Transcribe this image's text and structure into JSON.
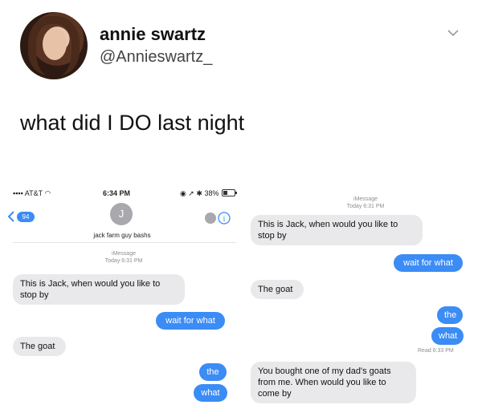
{
  "tweet": {
    "name": "annie swartz",
    "handle": "@Annieswartz_",
    "text": "what did I DO last night"
  },
  "left_screen": {
    "status_carrier": "AT&T",
    "status_time": "6:34 PM",
    "status_battery": "38%",
    "back_badge": "94",
    "contact_initial": "J",
    "contact_name": "jack farm guy bashs",
    "meta_service": "iMessage",
    "meta_time": "Today 6:31 PM",
    "messages": [
      {
        "dir": "in",
        "text": "This is Jack, when would you like to stop by"
      },
      {
        "dir": "out",
        "text": "wait for what"
      },
      {
        "dir": "in",
        "text": "The goat"
      },
      {
        "dir": "out",
        "text": "the"
      },
      {
        "dir": "out",
        "text": "what"
      }
    ]
  },
  "right_screen": {
    "meta_service": "iMessage",
    "meta_time": "Today 6:31 PM",
    "read_receipt": "Read 6:33 PM",
    "messages": [
      {
        "dir": "in",
        "text": "This is Jack, when would you like to stop by"
      },
      {
        "dir": "out",
        "text": "wait for what"
      },
      {
        "dir": "in",
        "text": "The goat"
      },
      {
        "dir": "out",
        "text": "the"
      },
      {
        "dir": "out",
        "text": "what"
      },
      {
        "dir": "in",
        "text": "You bought one of my dad's goats from me. When would you like to come by"
      }
    ]
  },
  "colors": {
    "imessage_blue": "#3b8cf5",
    "incoming_gray": "#e9e9eb"
  }
}
